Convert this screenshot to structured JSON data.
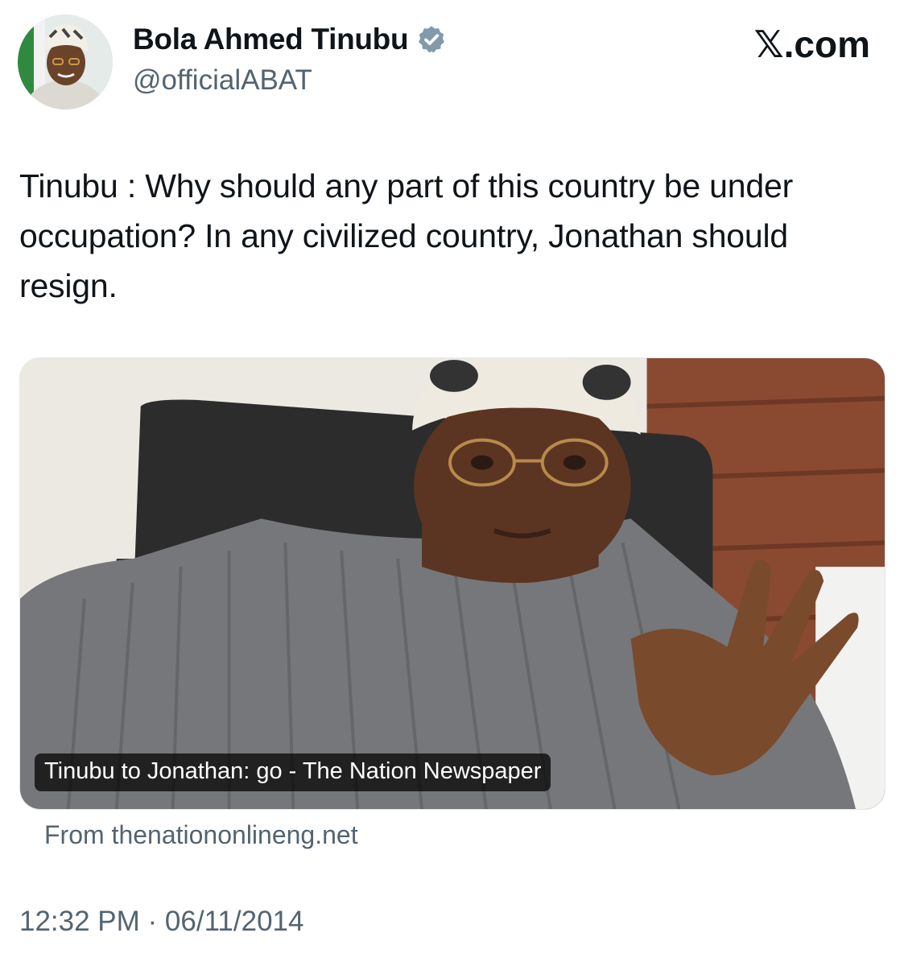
{
  "author": {
    "display_name": "Bola Ahmed Tinubu",
    "handle": "@officialABAT",
    "verified": true,
    "verified_icon": "verified-badge-icon"
  },
  "site": {
    "logo_text": "𝕏.com"
  },
  "tweet": {
    "text": "Tinubu :  Why should any part of this country be under occupation? In any civilized country, Jonathan should resign."
  },
  "link_card": {
    "caption": "Tinubu to Jonathan: go - The Nation Newspaper",
    "source": "From thenationonlineng.net"
  },
  "meta": {
    "timestamp": "12:32 PM · 06/11/2014"
  },
  "colors": {
    "primary_text": "#0f1419",
    "secondary_text": "#536471",
    "verified_badge": "#829aab"
  }
}
